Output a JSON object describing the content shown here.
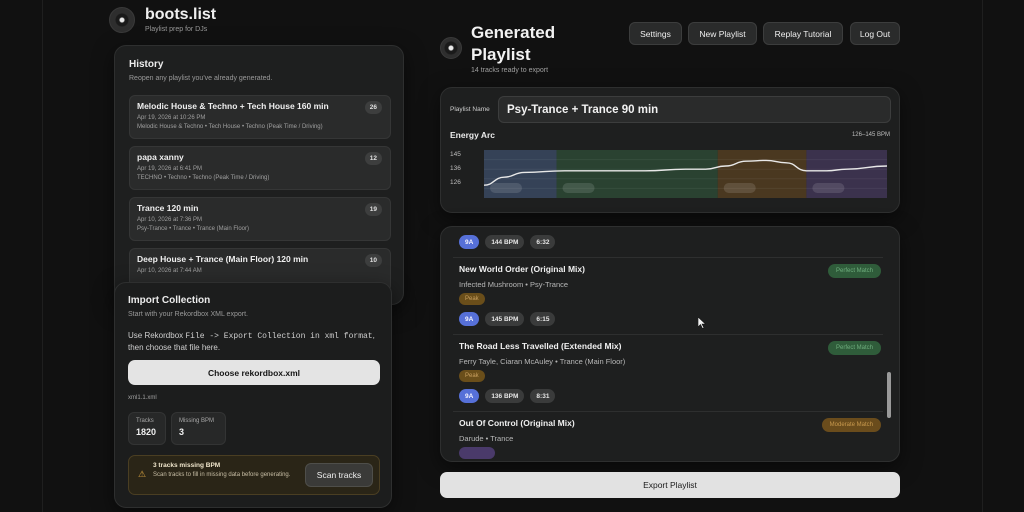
{
  "app": {
    "title": "boots.list",
    "subtitle": "Playlist prep for DJs"
  },
  "history": {
    "title": "History",
    "subtitle": "Reopen any playlist you've already generated.",
    "items": [
      {
        "name": "Melodic House & Techno + Tech House 160 min",
        "date": "Apr 19, 2026 at 10:26 PM",
        "tags": "Melodic House & Techno • Tech House • Techno (Peak Time / Driving)",
        "count": "26"
      },
      {
        "name": "papa xanny",
        "date": "Apr 19, 2026 at 6:41 PM",
        "tags": "TECHNO • Techno • Techno (Peak Time / Driving)",
        "count": "12"
      },
      {
        "name": "Trance 120 min",
        "date": "Apr 10, 2026 at 7:36 PM",
        "tags": "Psy-Trance • Trance • Trance (Main Floor)",
        "count": "19"
      },
      {
        "name": "Deep House + Trance (Main Floor) 120 min",
        "date": "Apr 10, 2026 at 7:44 AM",
        "tags": "",
        "count": "10"
      }
    ]
  },
  "import": {
    "title": "Import Collection",
    "subtitle": "Start with your Rekordbox XML export.",
    "desc_prefix": "Use Rekordbox ",
    "desc_code1": "File -> Export Collection in xml format",
    "desc_suffix": ", then choose that file here.",
    "choose_label": "Choose rekordbox.xml",
    "file_name": "xml1.1.xml",
    "stats": [
      {
        "label": "Tracks",
        "value": "1820"
      },
      {
        "label": "Missing BPM",
        "value": "3"
      }
    ],
    "warning_title": "3 tracks missing BPM",
    "warning_text": "Scan tracks to fill in missing data before generating.",
    "scan_label": "Scan tracks"
  },
  "generated": {
    "title": "Generated Playlist",
    "subtitle": "14 tracks ready to export"
  },
  "top_buttons": {
    "settings": "Settings",
    "new_playlist": "New Playlist",
    "replay": "Replay Tutorial",
    "logout": "Log Out"
  },
  "playlist": {
    "name_label": "Playlist Name",
    "name_value": "Psy-Trance + Trance 90 min"
  },
  "chart_data": {
    "type": "line",
    "title": "Energy Arc",
    "range_label": "126–145 BPM",
    "yticks": [
      "145",
      "136",
      "126"
    ],
    "ylim": [
      120,
      150
    ],
    "x": [
      0,
      0.05,
      0.1,
      0.2,
      0.3,
      0.4,
      0.5,
      0.55,
      0.6,
      0.65,
      0.7,
      0.75,
      0.8,
      0.85,
      0.9,
      1.0
    ],
    "values": [
      128,
      133,
      136,
      137,
      137,
      137,
      138,
      138,
      140,
      143,
      143.5,
      142,
      137,
      137,
      138,
      140
    ],
    "sections": [
      {
        "from": 0,
        "to": 0.18,
        "color": "#3d4f6b"
      },
      {
        "from": 0.18,
        "to": 0.58,
        "color": "#2f4f38"
      },
      {
        "from": 0.58,
        "to": 0.8,
        "color": "#5a4222"
      },
      {
        "from": 0.8,
        "to": 1.0,
        "color": "#463a5e"
      }
    ]
  },
  "tracks": [
    {
      "title": "",
      "artist": "",
      "energy": "",
      "key": "9A",
      "bpm": "144 BPM",
      "length": "6:32",
      "match": ""
    },
    {
      "title": "New World Order (Original Mix)",
      "artist": "Infected Mushroom • Psy-Trance",
      "energy": "Peak",
      "key": "9A",
      "bpm": "145 BPM",
      "length": "6:15",
      "match": "Perfect Match"
    },
    {
      "title": "The Road Less Travelled (Extended Mix)",
      "artist": "Ferry Tayle, Ciaran McAuley • Trance (Main Floor)",
      "energy": "Peak",
      "key": "9A",
      "bpm": "136 BPM",
      "length": "8:31",
      "match": "Perfect Match"
    },
    {
      "title": "Out Of Control (Original Mix)",
      "artist": "Darude • Trance",
      "energy": "",
      "key": "",
      "bpm": "",
      "length": "",
      "match": "Moderate Match"
    }
  ],
  "colors": {
    "key": "#5670d8",
    "perfect": "#3f7a4e",
    "moderate": "#8a6424",
    "peak": "#7a5a1e"
  },
  "export_label": "Export Playlist"
}
